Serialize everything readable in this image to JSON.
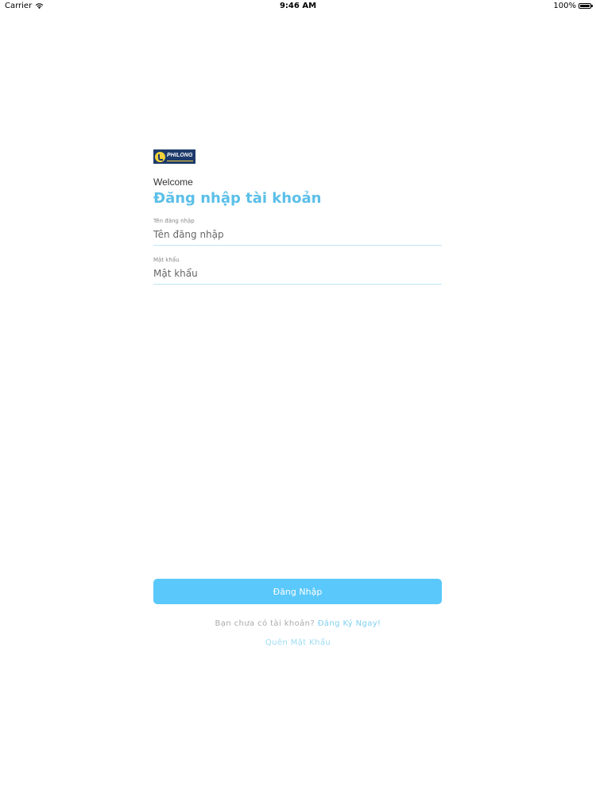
{
  "status_bar": {
    "carrier": "Carrier",
    "time": "9:46 AM",
    "battery_percent": "100%",
    "battery_level": 1.0,
    "wifi_icon": "wifi-icon",
    "battery_icon": "battery-icon"
  },
  "logo": {
    "text": "PHILONG",
    "icon": "philong-logo-mark",
    "colors": {
      "background": "#1d3a6b",
      "accent": "#f2d13a"
    }
  },
  "login": {
    "welcome": "Welcome",
    "title": "Đăng nhập tài khoản",
    "username": {
      "label": "Tên đăng nhập",
      "placeholder": "Tên đăng nhập",
      "value": ""
    },
    "password": {
      "label": "Mật khẩu",
      "placeholder": "Mật khẩu",
      "value": ""
    },
    "submit_label": "Đăng Nhập",
    "signup_prompt": "Bạn chưa có tài khoản?",
    "signup_link": "Đăng Ký Ngay!",
    "forgot_link": "Quên Mật Khẩu"
  },
  "colors": {
    "accent": "#5bbfe8",
    "button": "#5ac8fa",
    "underline": "#bfe6f5"
  }
}
